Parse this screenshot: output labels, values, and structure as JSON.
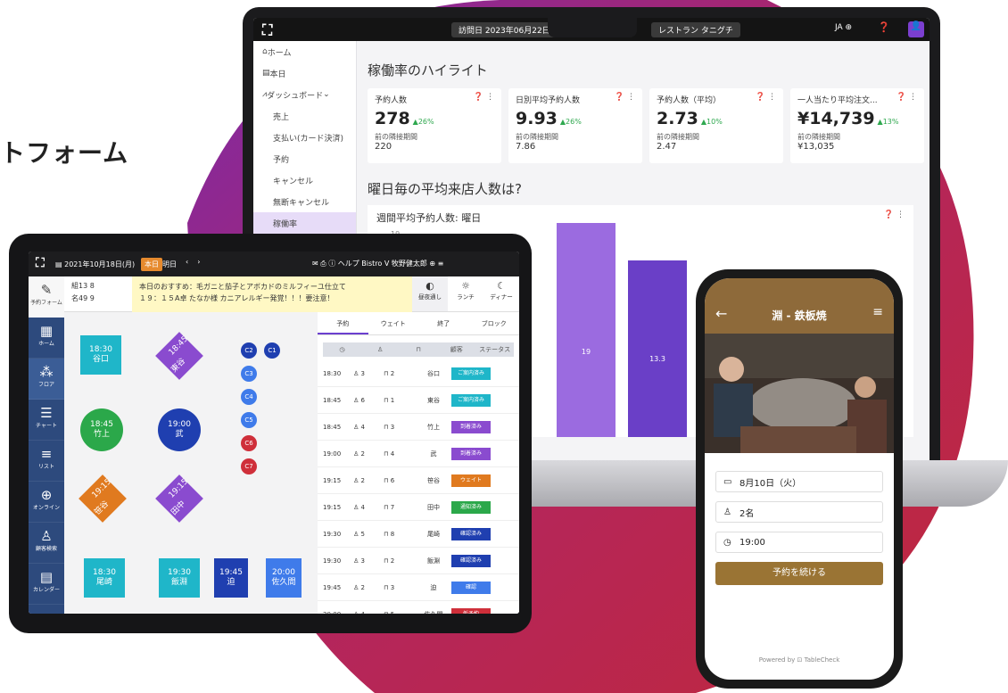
{
  "headline": "トフォーム",
  "laptop": {
    "date_range": "訪問日 2023年06月22日 ~ 20",
    "store": "レストラン タニグチ",
    "lang": "JA",
    "sidebar": [
      "ホーム",
      "本日",
      "ダッシュボード",
      "売上",
      "支払い(カード決済)",
      "予約",
      "キャンセル",
      "無断キャンセル",
      "稼働率"
    ],
    "section_title": "稼働率のハイライト",
    "cards": [
      {
        "label": "予約人数",
        "value": "278",
        "delta": "▲26%",
        "prev_label": "前の隣接期間",
        "prev": "220"
      },
      {
        "label": "日別平均予約人数",
        "value": "9.93",
        "delta": "▲26%",
        "prev_label": "前の隣接期間",
        "prev": "7.86"
      },
      {
        "label": "予約人数（平均）",
        "value": "2.73",
        "delta": "▲10%",
        "prev_label": "前の隣接期間",
        "prev": "2.47"
      },
      {
        "label": "一人当たり平均注文...",
        "value": "¥14,739",
        "delta": "▲13%",
        "prev_label": "前の隣接期間",
        "prev": "¥13,035"
      }
    ],
    "question": "曜日毎の平均来店人数は?",
    "chart_title": "週間平均予約人数: 曜日",
    "tick": "19",
    "bar_labels": [
      "19",
      "13.3"
    ]
  },
  "tablet": {
    "date": "2021年10月18日(月)",
    "today": "本日",
    "tomorrow": "明日",
    "right": "ヘルプ Bistro V 牧野健太郎",
    "sidebar": [
      "予約フォーム",
      "ホーム",
      "フロア",
      "チャート",
      "リスト",
      "オンライン",
      "顧客検索",
      "カレンダー"
    ],
    "info1": "組13 8",
    "info2": "名49 9",
    "note1": "本日のおすすめ：毛ガニと茄子とアボカドのミルフィーユ仕立て",
    "note2": "１９：１５A卓 たなか様 カニアレルギー発覚！！！要注意！",
    "meals": [
      "昼夜通し",
      "ランチ",
      "ディナー"
    ],
    "tables": [
      {
        "time": "18:30",
        "name": "谷口"
      },
      {
        "time": "18:45",
        "name": "東谷"
      },
      {
        "time": "18:45",
        "name": "竹上"
      },
      {
        "time": "19:00",
        "name": "武"
      },
      {
        "time": "19:15",
        "name": "笹谷"
      },
      {
        "time": "19:15",
        "name": "田中"
      },
      {
        "time": "18:30",
        "name": "尾崎"
      },
      {
        "time": "19:30",
        "name": "飯淵"
      },
      {
        "time": "19:45",
        "name": "迫"
      },
      {
        "time": "20:00",
        "name": "佐久間"
      }
    ],
    "circles": [
      "C2",
      "C1",
      "C3",
      "C4",
      "C5",
      "C6",
      "C7"
    ],
    "tabs": [
      "予約",
      "ウェイト",
      "終了",
      "ブロック"
    ],
    "head_cols": [
      "顧客",
      "ステータス"
    ],
    "rows": [
      {
        "time": "18:30",
        "people": "3",
        "table": "2",
        "name": "谷口",
        "status": "ご案内済み",
        "color": "#1fb6c9"
      },
      {
        "time": "18:45",
        "people": "6",
        "table": "1",
        "name": "東谷",
        "status": "ご案内済み",
        "color": "#1fb6c9"
      },
      {
        "time": "18:45",
        "people": "4",
        "table": "3",
        "name": "竹上",
        "status": "到着済み",
        "color": "#8a4bcf"
      },
      {
        "time": "19:00",
        "people": "2",
        "table": "4",
        "name": "武",
        "status": "到着済み",
        "color": "#8a4bcf"
      },
      {
        "time": "19:15",
        "people": "2",
        "table": "6",
        "name": "笹谷",
        "status": "ウェイト",
        "color": "#e07a1f"
      },
      {
        "time": "19:15",
        "people": "4",
        "table": "7",
        "name": "田中",
        "status": "通知済み",
        "color": "#2ba84a"
      },
      {
        "time": "19:30",
        "people": "5",
        "table": "8",
        "name": "尾崎",
        "status": "確認済み",
        "color": "#1f3fb0"
      },
      {
        "time": "19:30",
        "people": "3",
        "table": "2",
        "name": "飯淵",
        "status": "確認済み",
        "color": "#1f3fb0"
      },
      {
        "time": "19:45",
        "people": "2",
        "table": "3",
        "name": "迫",
        "status": "確認",
        "color": "#3f7bea"
      },
      {
        "time": "20:00",
        "people": "4",
        "table": "5",
        "name": "佐久間",
        "status": "仮予約",
        "color": "#cf2f3a"
      }
    ]
  },
  "phone": {
    "title": "淵 - 鉄板焼",
    "date": "8月10日（火）",
    "people": "2名",
    "time": "19:00",
    "cta": "予約を続ける",
    "powered": "Powered by ⊡ TableCheck"
  }
}
